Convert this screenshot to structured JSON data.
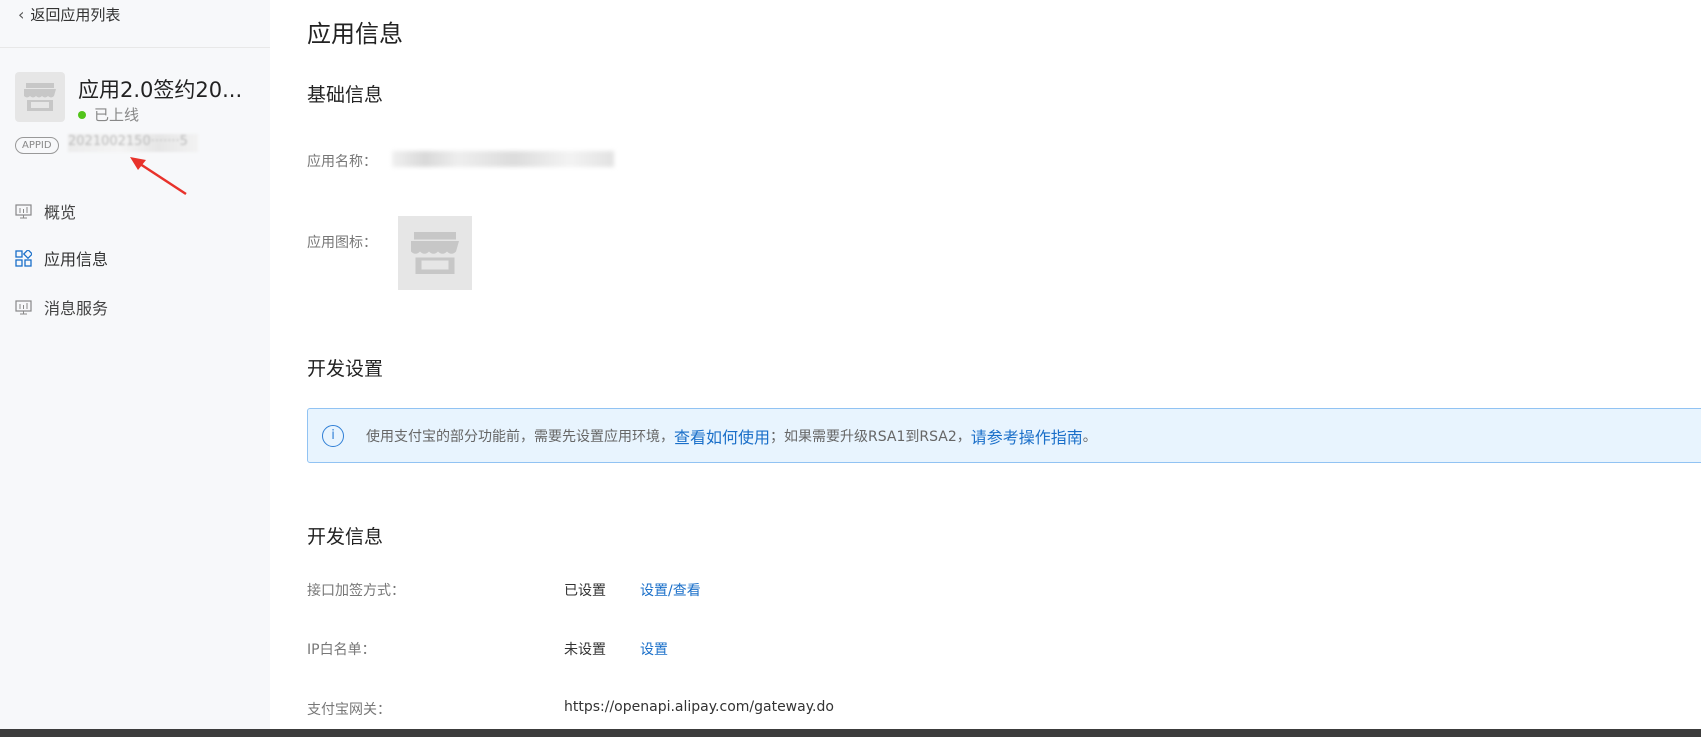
{
  "sidebar": {
    "back_label": "返回应用列表",
    "app_name": "应用2.0签约20...",
    "app_status": "已上线",
    "appid_tag": "APPID",
    "appid_value": "2021002150·······5",
    "nav": [
      {
        "label": "概览",
        "icon": "monitor-icon"
      },
      {
        "label": "应用信息",
        "icon": "grid-icon"
      },
      {
        "label": "消息服务",
        "icon": "monitor-icon"
      }
    ]
  },
  "main": {
    "page_title": "应用信息",
    "basic": {
      "title": "基础信息",
      "app_name_label": "应用名称：",
      "app_icon_label": "应用图标："
    },
    "dev_settings": {
      "title": "开发设置",
      "notice": {
        "text1": "使用支付宝的部分功能前，需要先设置应用环境，",
        "link1": "查看如何使用",
        "text2": "；如果需要升级RSA1到RSA2，",
        "link2": "请参考操作指南",
        "text3": "。"
      }
    },
    "dev_info": {
      "title": "开发信息",
      "rows": [
        {
          "label": "接口加签方式：",
          "value": "已设置",
          "link": "设置/查看"
        },
        {
          "label": "IP白名单：",
          "value": "未设置",
          "link": "设置"
        },
        {
          "label": "支付宝网关：",
          "value": "https://openapi.alipay.com/gateway.do"
        }
      ]
    }
  },
  "colors": {
    "link": "#1a6fc9",
    "online": "#52c41a",
    "arrow": "#e8322b"
  }
}
